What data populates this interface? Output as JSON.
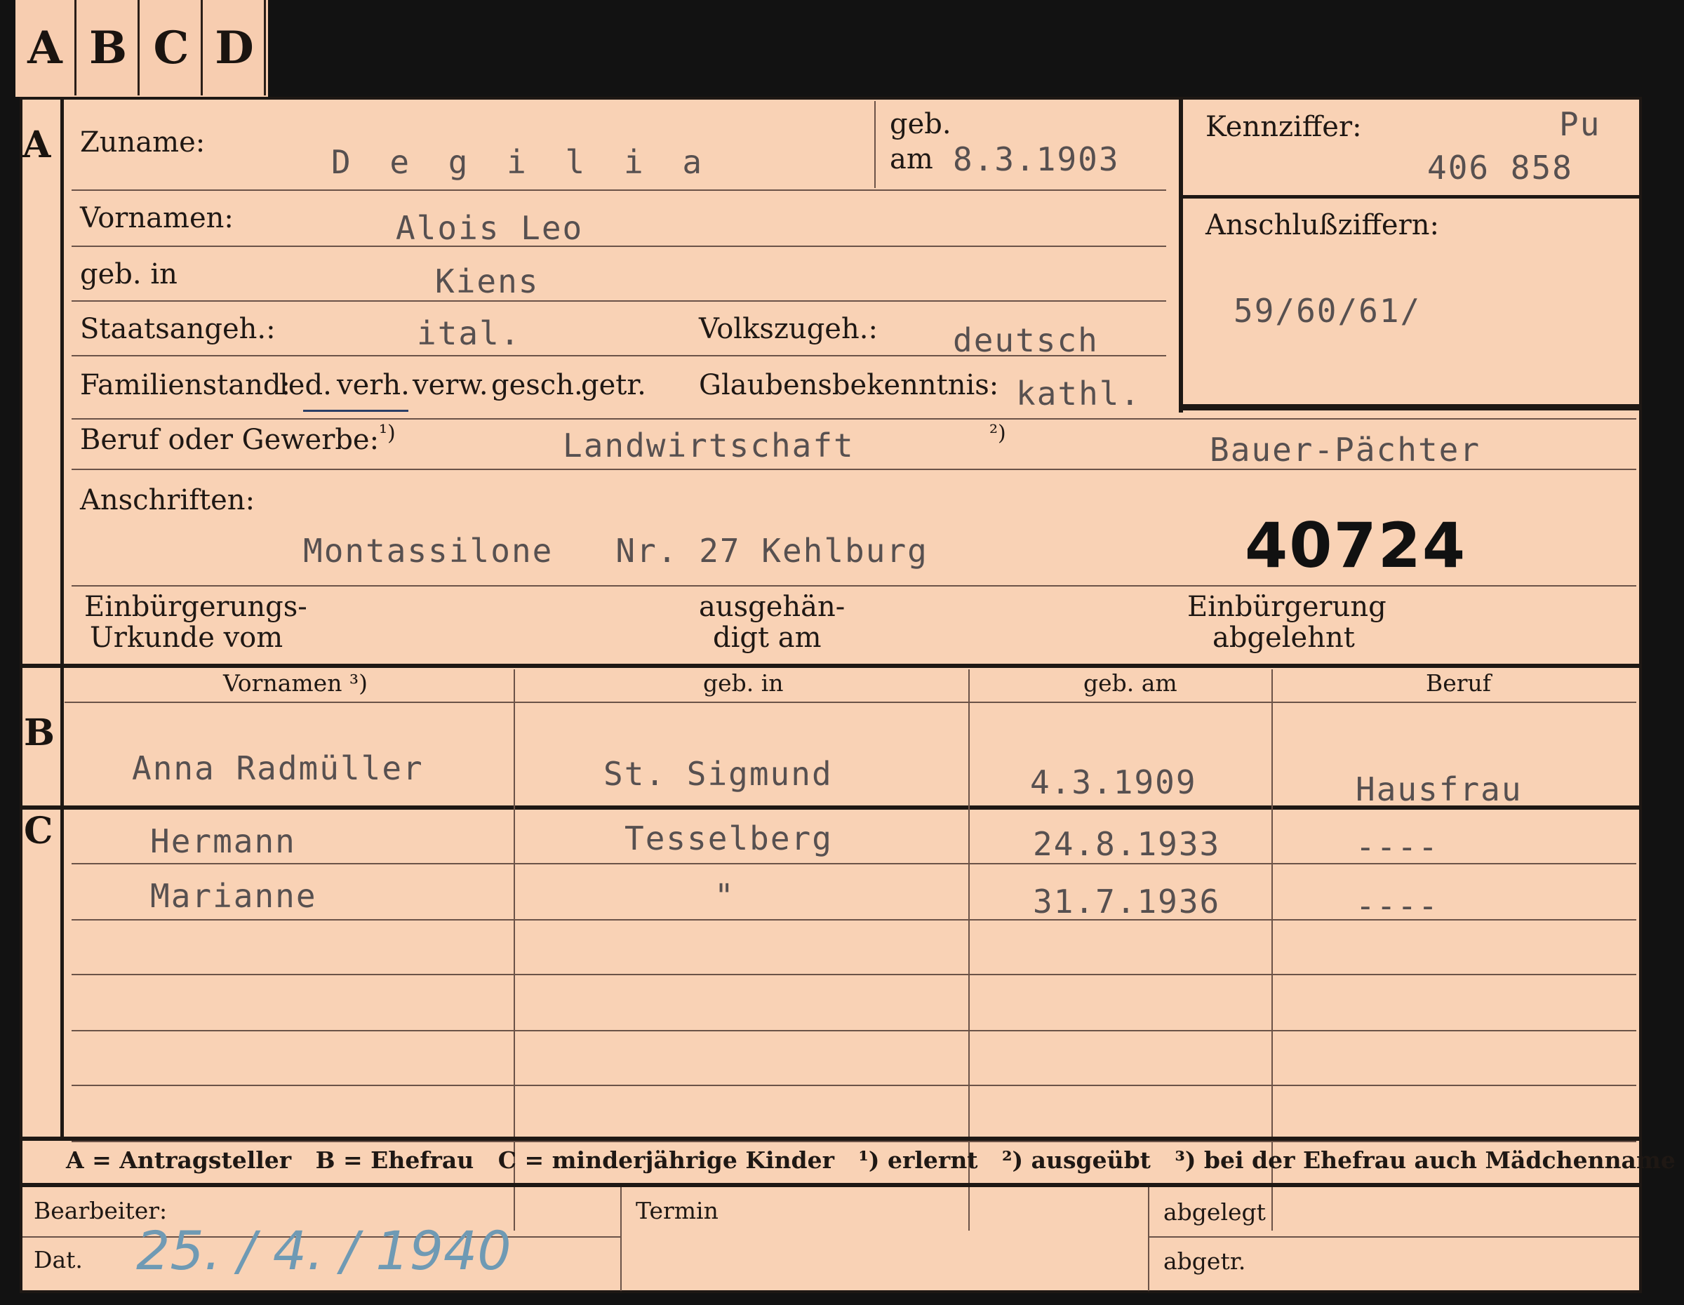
{
  "tabs": [
    "A",
    "B",
    "C",
    "D"
  ],
  "section_a": {
    "letter": "A",
    "zuname_label": "Zuname:",
    "zuname_value": "D e g i l i a",
    "geb_label": "geb.",
    "am_label": "am",
    "geb_am_value": "8.3.1903",
    "kennziffer_label": "Kennziffer:",
    "kennziffer_code": "Pu",
    "kennziffer_value": "406 858",
    "anschluss_label": "Anschlußziffern:",
    "anschluss_value": "59/60/61/",
    "vornamen_label": "Vornamen:",
    "vornamen_value": "Alois Leo",
    "geb_in_label": "geb. in",
    "geb_in_value": "Kiens",
    "staats_label": "Staatsangeh.:",
    "staats_value": "ital.",
    "volks_label": "Volkszugeh.:",
    "volks_value": "deutsch",
    "familien_label": "Familienstand:",
    "familien_options": [
      "led.",
      "verh.",
      "verw.",
      "gesch.",
      "getr."
    ],
    "glaubens_label": "Glaubensbekenntnis:",
    "glaubens_value": "kathl.",
    "beruf_label": "Beruf oder Gewerbe:",
    "beruf_mark1": "¹)",
    "beruf_value1": "Landwirtschaft",
    "beruf_mark2": "²)",
    "beruf_value2": "Bauer-Pächter",
    "anschriften_label": "Anschriften:",
    "anschriften_value": "Montassilone   Nr. 27 Kehlburg",
    "stamp_number": "40724",
    "einb_urkunde_l1": "Einbürgerungs-",
    "einb_urkunde_l2": "Urkunde vom",
    "ausgeh_l1": "ausgehän-",
    "ausgeh_l2": "digt am",
    "einb_abgelehnt_l1": "Einbürgerung",
    "einb_abgelehnt_l2": "abgelehnt"
  },
  "section_b": {
    "letter": "B",
    "headers": [
      "Vornamen ³)",
      "geb. in",
      "geb. am",
      "Beruf"
    ],
    "row": [
      "Anna Radmüller",
      "St. Sigmund",
      "4.3.1909",
      "Hausfrau"
    ]
  },
  "section_c": {
    "letter": "C",
    "rows": [
      [
        "Hermann",
        "Tesselberg",
        "24.8.1933",
        "----"
      ],
      [
        "Marianne",
        "\"",
        "31.7.1936",
        "----"
      ]
    ]
  },
  "legend": {
    "text": "A = Antragsteller   B = Ehefrau   C = minderjährige Kinder   ¹) erlernt   ²) ausgeübt   ³) bei der Ehefrau auch Mädchenname"
  },
  "footer": {
    "bearbeiter_label": "Bearbeiter:",
    "dat_label": "Dat.",
    "date_written": "25. / 4. / 1940",
    "termin_label": "Termin",
    "abgelegt_label": "abgelegt",
    "abgetr_label": "abgetr."
  }
}
